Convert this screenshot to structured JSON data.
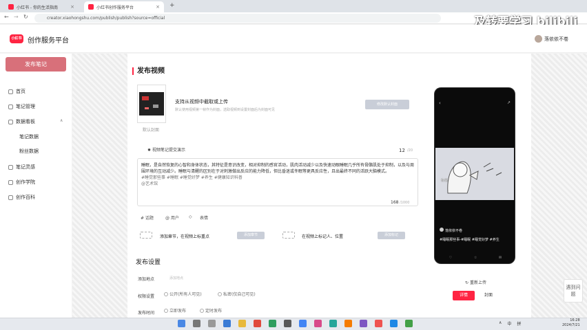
{
  "browser": {
    "tabs": [
      {
        "label": "小红书 - 你的生活指南"
      },
      {
        "label": "小红书创作服务平台"
      }
    ],
    "url": "creator.xiaohongshu.com/publish/publish?source=official"
  },
  "overlay": {
    "text": "及转要学习 bilibili"
  },
  "header": {
    "logo": "小红书",
    "brand": "创作服务平台",
    "username": "落依依不卷"
  },
  "sidebar": {
    "publish_button": "发布笔记",
    "items": [
      {
        "label": "首页"
      },
      {
        "label": "笔记管理"
      },
      {
        "label": "数据看板"
      },
      {
        "label": "笔记数据"
      },
      {
        "label": "粉丝数据"
      },
      {
        "label": "笔记灵感"
      },
      {
        "label": "创作学院"
      },
      {
        "label": "创作百科"
      }
    ]
  },
  "main": {
    "section_title": "发布视频",
    "cover_label": "默认封面",
    "upload_title": "支持从视频中截取或上传",
    "upload_hint": "默认使用视频第一帧作为封面，选取视频到设置封面后为封面可见",
    "reupload_cover_button": "修改默认封面",
    "demo_link": "视频笔记提交演示",
    "title_count": "12",
    "title_max": "/20",
    "description": "睡眠，是自然恢复的心智和身体状态，其特征是意识改变，相对抑制的感官活动，肌肉活动减少以及快速动眼睡眠几乎所有骨骼肌处于抑制，以及与周围环境的互动减少。睡眠与清醒的区别在于对刺激做出反应的能力降低，但比昏迷或冬眠等更具反应性，且出最终不同的活跃大脑模式。",
    "topics": "#睡觉那些事 #睡眠 #睡觉好梦 #养生 #健康知识科普",
    "mention": "@艺术馆",
    "desc_count": "168",
    "desc_max": "/1000",
    "tools": [
      {
        "label": "# 话题"
      },
      {
        "label": "@ 用户"
      },
      {
        "label": "表情"
      }
    ],
    "chapter_label": "添加章节，在视频上标重点",
    "chapter_button": "添加章节",
    "tag_label": "在视频上标记人、位置",
    "tag_button": "添加标记"
  },
  "settings": {
    "title": "发布设置",
    "location_label": "添加地点",
    "location_placeholder": "添加地点",
    "permission_label": "权限设置",
    "permission_public": "公开(所有人可见)",
    "permission_private": "私密(仅自己可见)",
    "publish_time_label": "发布时间",
    "publish_now": "立即发布",
    "publish_scheduled": "定时发布"
  },
  "preview": {
    "hand_note": "你爸",
    "username": "落依依不卷",
    "caption": "#睡眠那些事-#睡眠 #睡觉好梦 #养生",
    "icons": [
      "♡",
      "☆",
      "✉"
    ],
    "reupload_link": "重新上传",
    "tabs": [
      {
        "label": "详情"
      },
      {
        "label": "封面"
      }
    ]
  },
  "help": {
    "label": "遇到问题"
  },
  "taskbar": {
    "tray": [
      "∧",
      "中",
      "拼"
    ],
    "time": "16:28",
    "date": "2024/7/21"
  },
  "colors": {
    "brand_red": "#ff2442",
    "publish_button": "#d8707a",
    "disabled_button": "#c9ced8"
  }
}
